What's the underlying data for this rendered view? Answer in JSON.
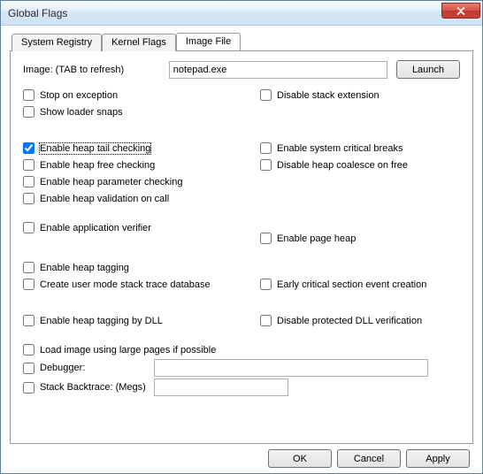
{
  "window": {
    "title": "Global Flags"
  },
  "tabs": {
    "registry": "System Registry",
    "kernel": "Kernel Flags",
    "imagefile": "Image File"
  },
  "image": {
    "label": "Image: (TAB to refresh)",
    "value": "notepad.exe",
    "launch": "Launch"
  },
  "group1": {
    "stop_on_exception": "Stop on exception",
    "show_loader_snaps": "Show loader snaps",
    "disable_stack_extension": "Disable stack extension"
  },
  "group_heap": {
    "tail": "Enable heap tail checking",
    "free": "Enable heap free checking",
    "param": "Enable heap parameter checking",
    "valid": "Enable heap validation on call",
    "sys_critical": "Enable system critical breaks",
    "disable_coalesce": "Disable heap coalesce on free"
  },
  "group_verifier": {
    "app_verifier": "Enable application verifier",
    "page_heap": "Enable page heap"
  },
  "group_tag": {
    "heap_tagging": "Enable heap tagging",
    "stack_trace_db": "Create user mode stack trace database",
    "early_cs": "Early critical section event creation"
  },
  "group_dll": {
    "tag_by_dll": "Enable heap tagging by DLL",
    "disable_prot_dll": "Disable protected DLL verification"
  },
  "group_bottom": {
    "large_pages": "Load image using large pages if possible",
    "debugger": "Debugger:",
    "backtrace": "Stack Backtrace: (Megs)"
  },
  "buttons": {
    "ok": "OK",
    "cancel": "Cancel",
    "apply": "Apply"
  },
  "state": {
    "tail_checked": true
  }
}
